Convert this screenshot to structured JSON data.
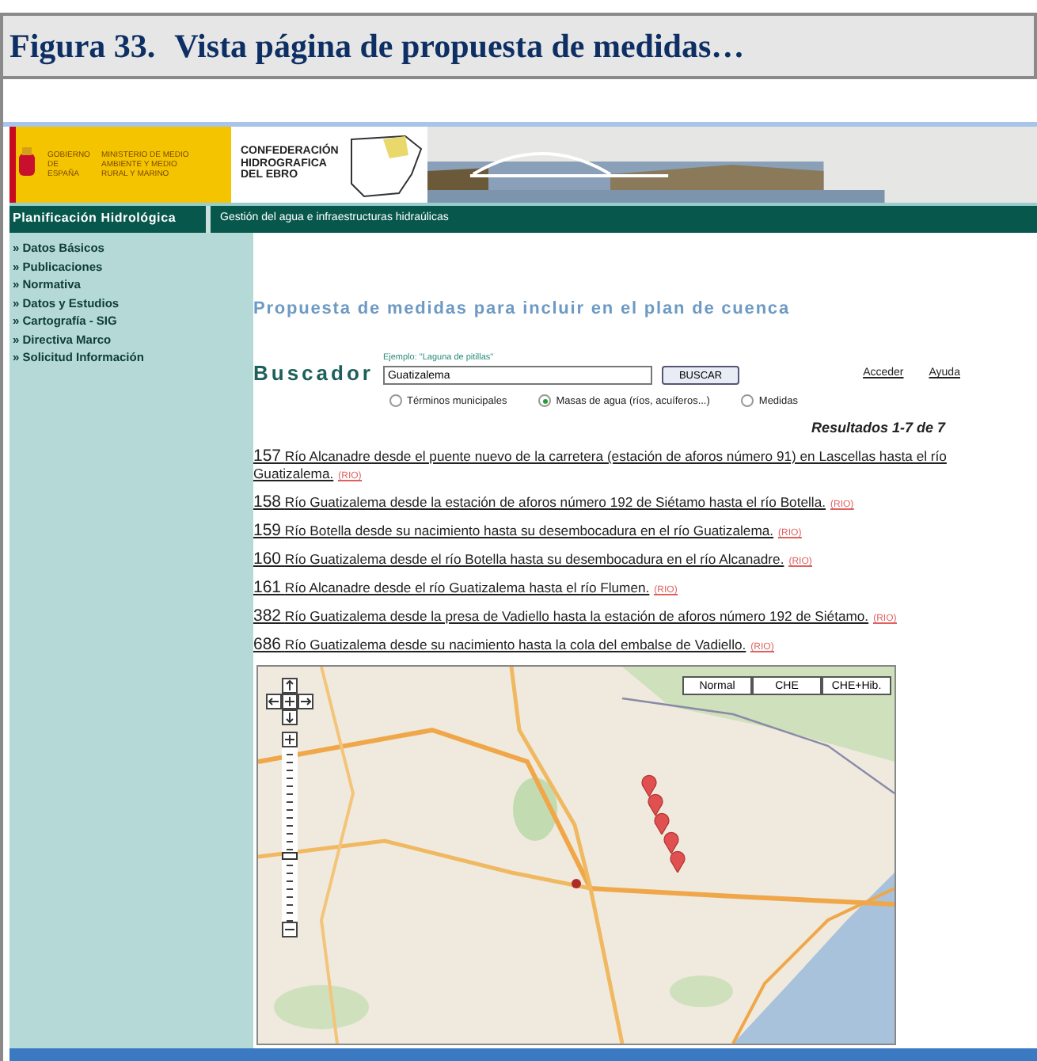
{
  "figure_caption": {
    "label": "Figura 33.",
    "title": "Vista página de propuesta de medidas…"
  },
  "banner": {
    "government": "GOBIERNO DE ESPAÑA",
    "ministry": "MINISTERIO DE MEDIO AMBIENTE Y MEDIO RURAL Y MARINO",
    "agency": "CONFEDERACIÓN HIDROGRAFICA DEL EBRO"
  },
  "nav_bar": {
    "section": "Planificación Hidrológica",
    "subtitle": "Gestión del agua e infraestructuras hidraúlicas"
  },
  "sidebar": {
    "items": [
      "» Datos Básicos",
      "» Publicaciones",
      "» Normativa",
      "» Datos y Estudios",
      "» Cartografía - SIG",
      "» Directiva Marco",
      "» Solicitud Información"
    ]
  },
  "page_title": "Propuesta de medidas para incluir en el plan de cuenca",
  "search": {
    "label": "Buscador",
    "example": "Ejemplo: \"Laguna de pitillas\"",
    "value": "Guatizalema",
    "button": "BUSCAR"
  },
  "links": [
    "Acceder",
    "Ayuda"
  ],
  "scopes": [
    {
      "label": "Términos municipales",
      "selected": false
    },
    {
      "label": "Masas de agua (ríos, acuíferos...)",
      "selected": true
    },
    {
      "label": "Medidas",
      "selected": false
    }
  ],
  "results_count": "Resultados 1-7 de 7",
  "results": [
    {
      "number": "157",
      "text": "Río Alcanadre desde el puente nuevo de la carretera (estación de aforos número 91) en Lascellas hasta el río Guatizalema.",
      "tag": "(RIO)"
    },
    {
      "number": "158",
      "text": "Río Guatizalema desde la estación de aforos número 192 de Siétamo hasta el río Botella.",
      "tag": "(RIO)"
    },
    {
      "number": "159",
      "text": "Río Botella desde su nacimiento hasta su desembocadura en el río Guatizalema.",
      "tag": "(RIO)"
    },
    {
      "number": "160",
      "text": "Río Guatizalema desde el río Botella hasta su desembocadura en el río Alcanadre.",
      "tag": "(RIO)"
    },
    {
      "number": "161",
      "text": "Río Alcanadre desde el río Guatizalema hasta el río Flumen.",
      "tag": "(RIO)"
    },
    {
      "number": "382",
      "text": "Río Guatizalema desde la presa de Vadiello hasta la estación de aforos número 192 de Siétamo.",
      "tag": "(RIO)"
    },
    {
      "number": "686",
      "text": "Río Guatizalema desde su nacimiento hasta la cola del embalse de Vadiello.",
      "tag": "(RIO)"
    }
  ],
  "map": {
    "types": [
      "Normal",
      "CHE",
      "CHE+Hib."
    ],
    "zoom": {
      "level": 0.38
    }
  }
}
